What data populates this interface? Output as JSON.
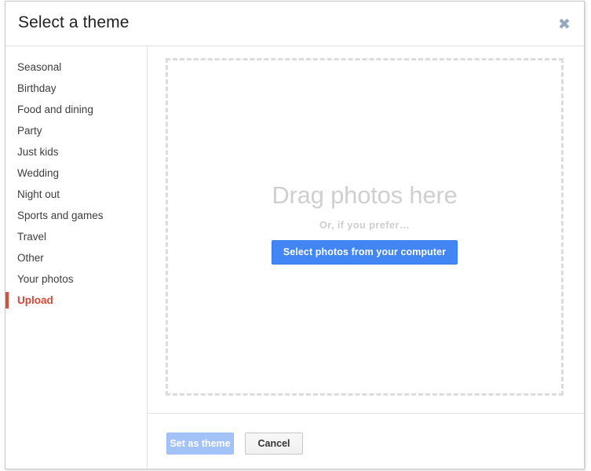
{
  "dialog": {
    "title": "Select a theme",
    "close_icon": "close-icon",
    "close_glyph": "✖"
  },
  "sidebar": {
    "items": [
      {
        "label": "Seasonal",
        "selected": false
      },
      {
        "label": "Birthday",
        "selected": false
      },
      {
        "label": "Food and dining",
        "selected": false
      },
      {
        "label": "Party",
        "selected": false
      },
      {
        "label": "Just kids",
        "selected": false
      },
      {
        "label": "Wedding",
        "selected": false
      },
      {
        "label": "Night out",
        "selected": false
      },
      {
        "label": "Sports and games",
        "selected": false
      },
      {
        "label": "Travel",
        "selected": false
      },
      {
        "label": "Other",
        "selected": false
      },
      {
        "label": "Your photos",
        "selected": false
      },
      {
        "label": "Upload",
        "selected": true
      }
    ]
  },
  "dropzone": {
    "drag_text": "Drag photos here",
    "or_text": "Or, if you prefer…",
    "select_button_label": "Select photos from your computer"
  },
  "footer": {
    "primary_label": "Set as theme",
    "secondary_label": "Cancel"
  },
  "colors": {
    "accent_blue": "#4285f4",
    "disabled_blue": "#a3c2f7",
    "selected_red": "#d14836",
    "indicator_red": "#dd4b39",
    "placeholder_gray": "#cfcfcf",
    "dashed_border": "#dcdcdc",
    "close_icon": "#93a8c0"
  }
}
